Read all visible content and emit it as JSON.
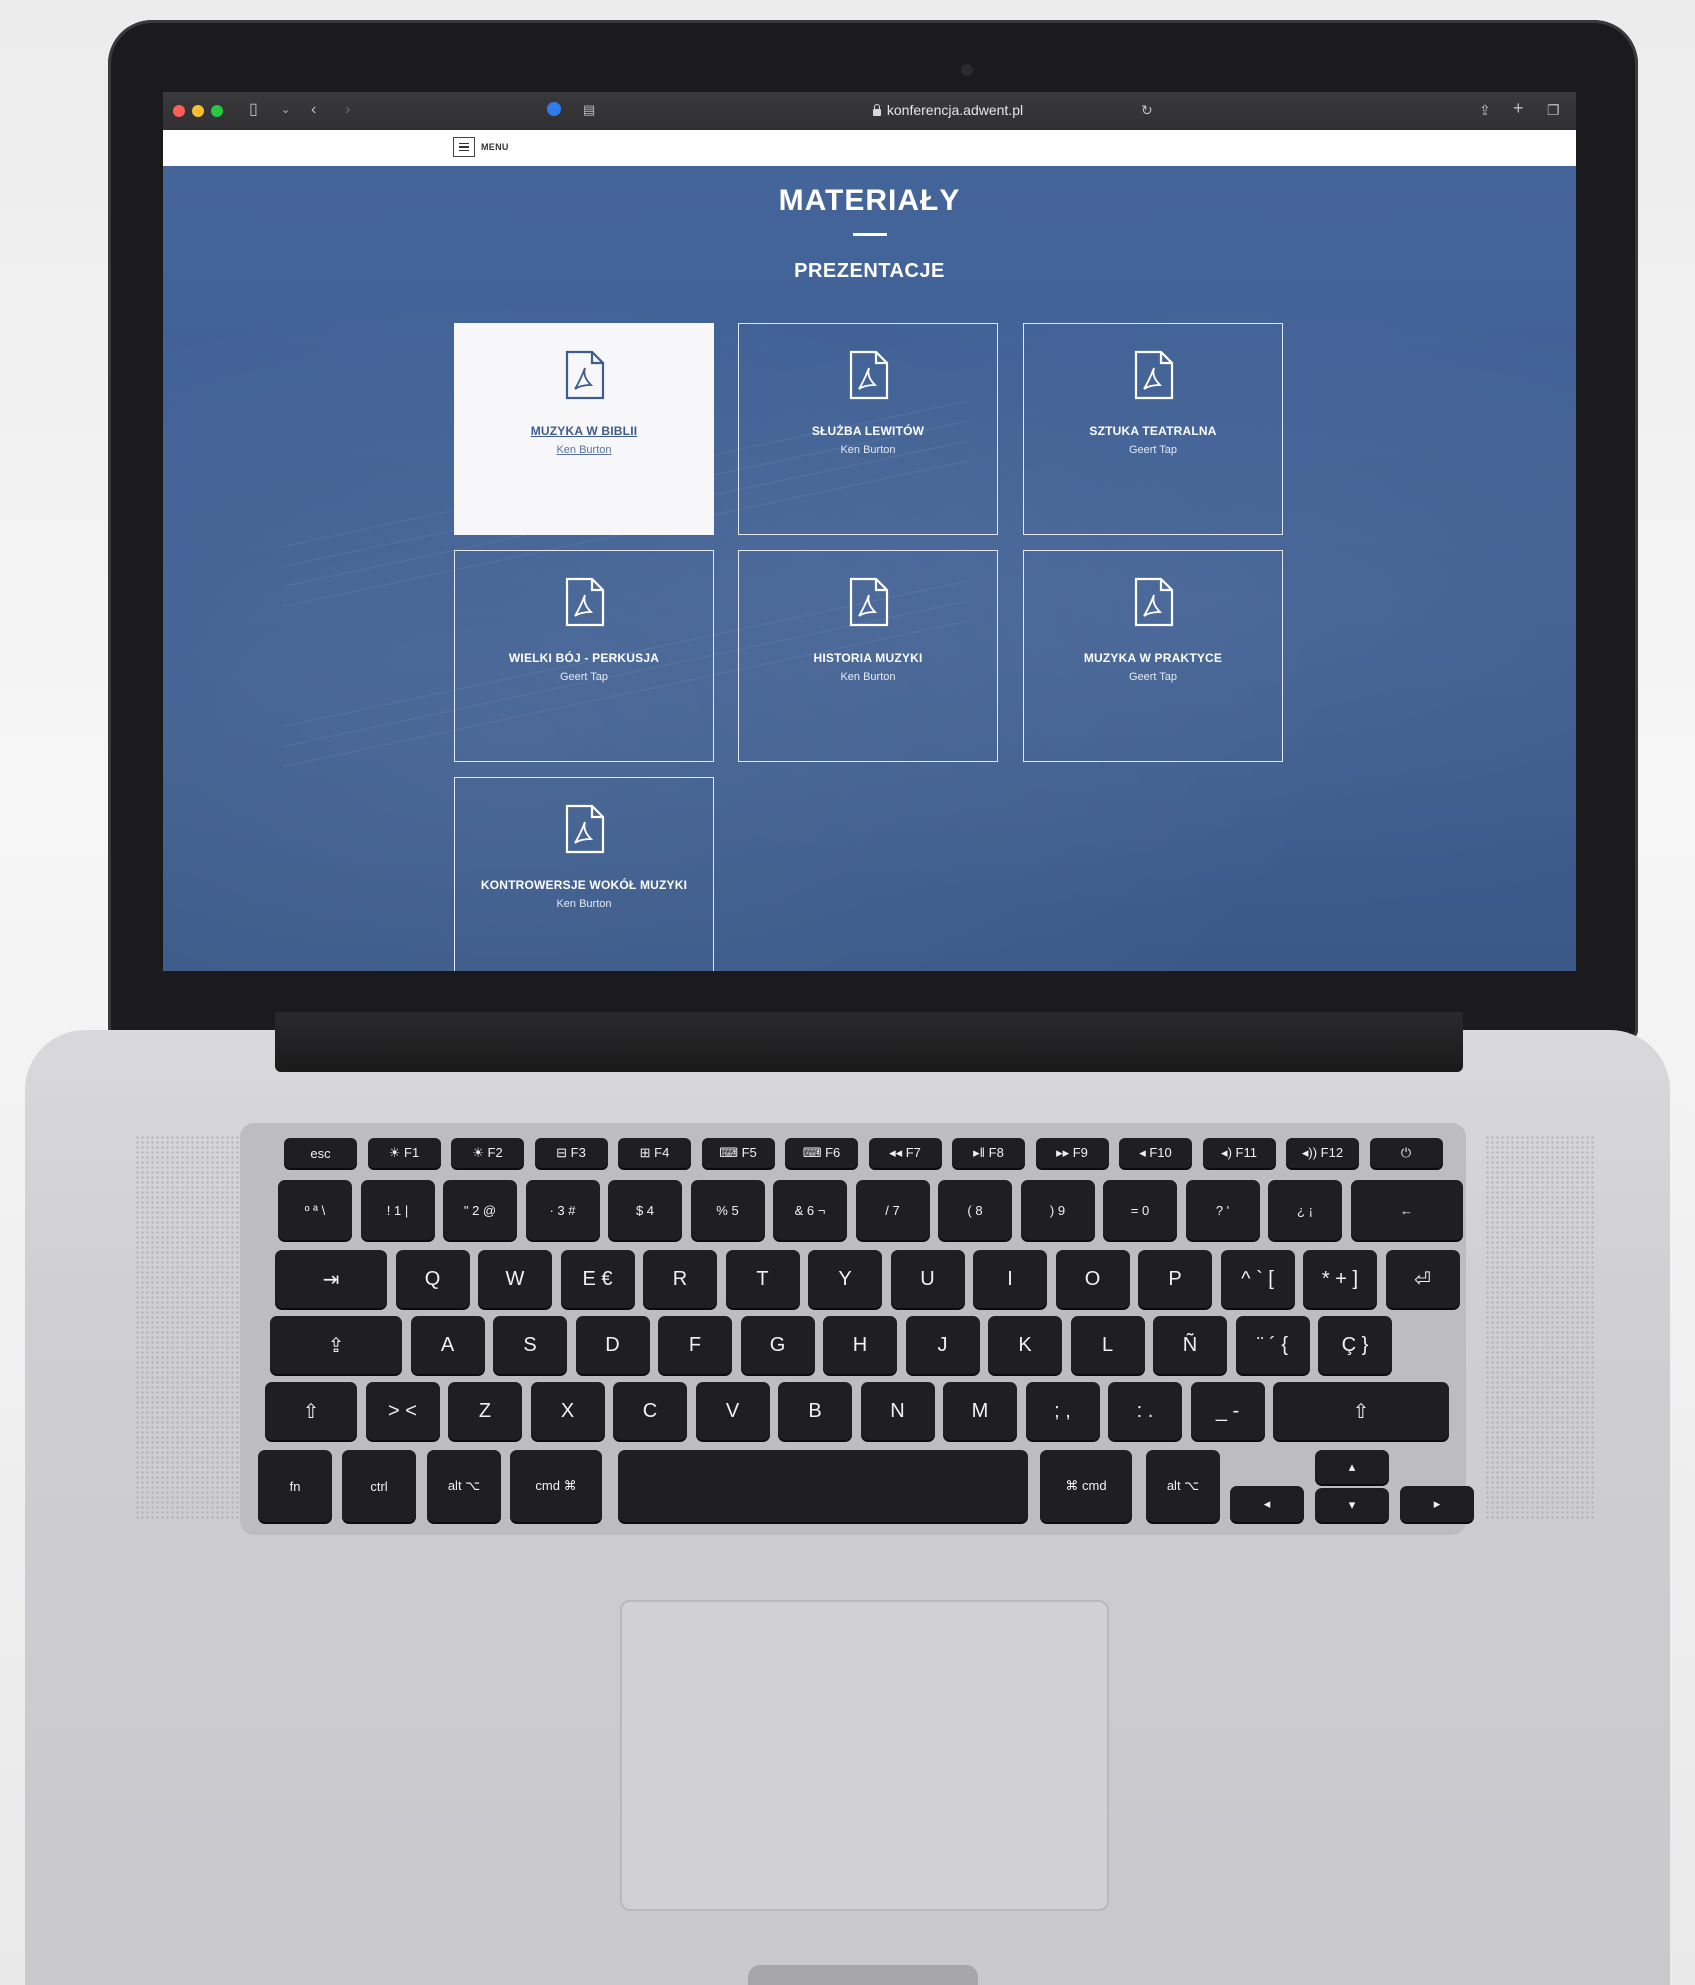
{
  "browser": {
    "url": "konferencja.adwent.pl"
  },
  "header": {
    "menu_label": "MENU"
  },
  "page": {
    "title": "MATERIAŁY",
    "section_title": "PREZENTACJE"
  },
  "cards": [
    {
      "title": "MUZYKA W BIBLII",
      "author": "Ken Burton",
      "active": true
    },
    {
      "title": "SŁUŻBA LEWITÓW",
      "author": "Ken Burton",
      "active": false
    },
    {
      "title": "SZTUKA TEATRALNA",
      "author": "Geert Tap",
      "active": false
    },
    {
      "title": "WIELKI BÓJ - PERKUSJA",
      "author": "Geert Tap",
      "active": false
    },
    {
      "title": "HISTORIA MUZYKI",
      "author": "Ken Burton",
      "active": false
    },
    {
      "title": "MUZYKA W PRAKTYCE",
      "author": "Geert Tap",
      "active": false
    },
    {
      "title": "KONTROWERSJE WOKÓŁ MUZYKI",
      "author": "Ken Burton",
      "active": false
    }
  ],
  "keyboard": {
    "fn_row": [
      "esc",
      "☀ F1",
      "☀ F2",
      "⊟ F3",
      "⊞ F4",
      "⌨ F5",
      "⌨ F6",
      "◂◂ F7",
      "▸ǁ F8",
      "▸▸ F9",
      "◂ F10",
      "◂) F11",
      "◂)) F12",
      "⏻"
    ],
    "row1": [
      "º ª \\",
      "! 1 |",
      "\" 2 @",
      "· 3 #",
      "$ 4",
      "% 5",
      "& 6 ¬",
      "/ 7",
      "( 8",
      ") 9",
      "= 0",
      "? '",
      "¿ ¡",
      "←"
    ],
    "row2": [
      "⇥",
      "Q",
      "W",
      "E €",
      "R",
      "T",
      "Y",
      "U",
      "I",
      "O",
      "P",
      "^ ` [",
      "* + ]",
      "⏎"
    ],
    "row3": [
      "⇪",
      "A",
      "S",
      "D",
      "F",
      "G",
      "H",
      "J",
      "K",
      "L",
      "Ñ",
      "¨ ´ {",
      "Ç }"
    ],
    "row4": [
      "⇧",
      "> <",
      "Z",
      "X",
      "C",
      "V",
      "B",
      "N",
      "M",
      "; ,",
      ": .",
      "_ -",
      "⇧"
    ],
    "row5": [
      "fn",
      "ctrl",
      "alt ⌥",
      "cmd ⌘",
      "",
      "⌘ cmd",
      "alt ⌥",
      "◂",
      "▴",
      "▾",
      "▸"
    ]
  }
}
